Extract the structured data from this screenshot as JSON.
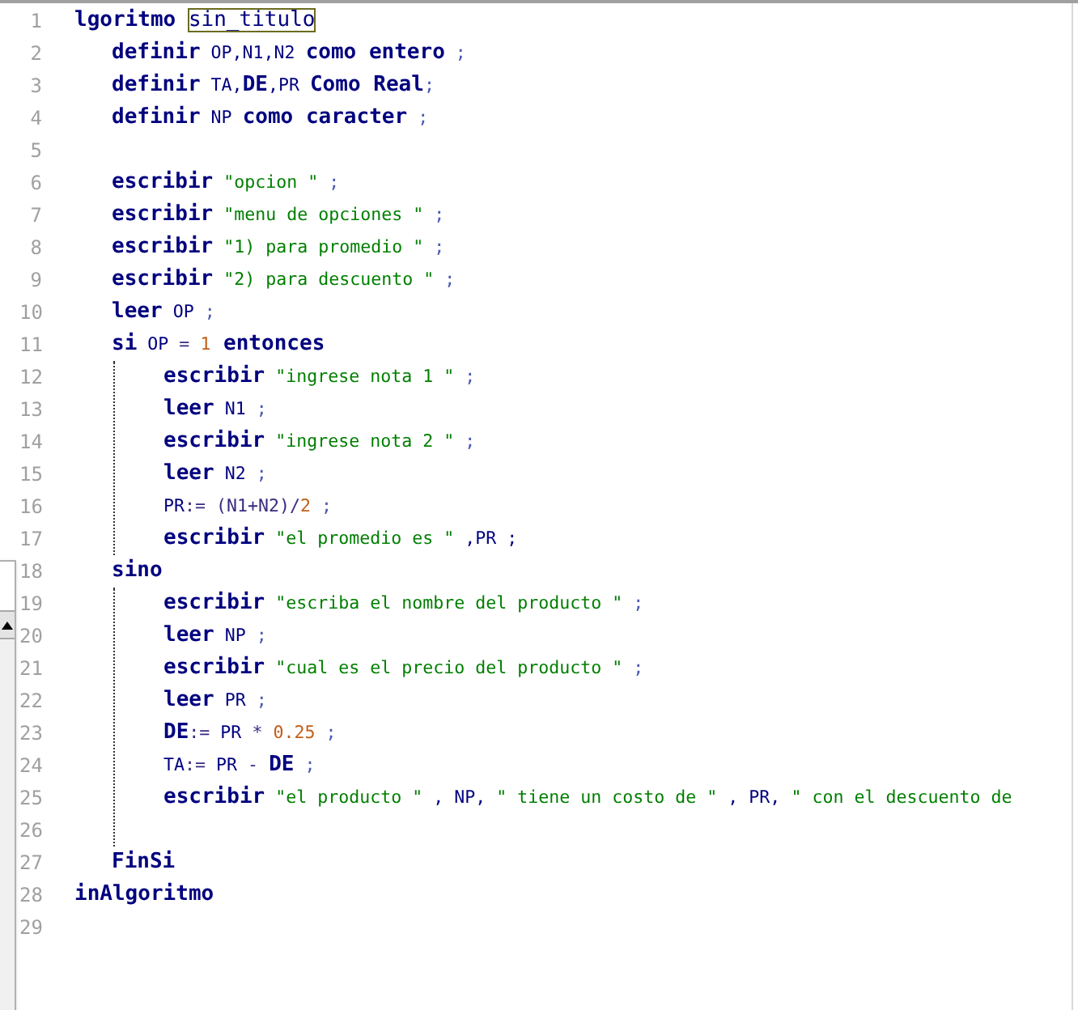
{
  "editor": {
    "lines": [
      {
        "number": "1",
        "tokens": [
          {
            "kind": "keyword",
            "text": "lgoritmo "
          },
          {
            "kind": "marked",
            "text": "sin_titulo"
          }
        ],
        "children": [
          {
            "number": "2",
            "tokens": [
              {
                "kind": "keyword",
                "text": "definir"
              },
              {
                "kind": "ident",
                "text": " OP,N1,N2 "
              },
              {
                "kind": "keyword",
                "text": "como entero"
              },
              {
                "kind": "punct",
                "text": " ;"
              }
            ]
          },
          {
            "number": "3",
            "tokens": [
              {
                "kind": "keyword",
                "text": "definir"
              },
              {
                "kind": "ident",
                "text": " TA,"
              },
              {
                "kind": "keyword",
                "text": "DE"
              },
              {
                "kind": "ident",
                "text": ",PR "
              },
              {
                "kind": "keyword",
                "text": "Como Real"
              },
              {
                "kind": "punct",
                "text": ";"
              }
            ]
          },
          {
            "number": "4",
            "tokens": [
              {
                "kind": "keyword",
                "text": "definir"
              },
              {
                "kind": "ident",
                "text": " NP "
              },
              {
                "kind": "keyword",
                "text": "como caracter"
              },
              {
                "kind": "punct",
                "text": " ;"
              }
            ]
          },
          {
            "number": "5"
          },
          {
            "number": "6",
            "tokens": [
              {
                "kind": "keyword",
                "text": "escribir"
              },
              {
                "kind": "string",
                "text": " \"opcion \""
              },
              {
                "kind": "punct",
                "text": " ;"
              }
            ]
          },
          {
            "number": "7",
            "tokens": [
              {
                "kind": "keyword",
                "text": "escribir"
              },
              {
                "kind": "string",
                "text": " \"menu de opciones \""
              },
              {
                "kind": "punct",
                "text": " ;"
              }
            ]
          },
          {
            "number": "8",
            "tokens": [
              {
                "kind": "keyword",
                "text": "escribir"
              },
              {
                "kind": "string",
                "text": " \"1) para promedio \""
              },
              {
                "kind": "punct",
                "text": " ;"
              }
            ]
          },
          {
            "number": "9",
            "tokens": [
              {
                "kind": "keyword",
                "text": "escribir"
              },
              {
                "kind": "string",
                "text": " \"2) para descuento \""
              },
              {
                "kind": "punct",
                "text": " ;"
              }
            ]
          },
          {
            "number": "10",
            "tokens": [
              {
                "kind": "keyword",
                "text": "leer"
              },
              {
                "kind": "ident",
                "text": " OP"
              },
              {
                "kind": "punct",
                "text": " ;"
              }
            ]
          },
          {
            "number": "11",
            "tokens": [
              {
                "kind": "keyword",
                "text": "si"
              },
              {
                "kind": "ident",
                "text": " OP "
              },
              {
                "kind": "op",
                "text": "= "
              },
              {
                "kind": "number",
                "text": "1"
              },
              {
                "kind": "keyword",
                "text": " entonces"
              }
            ],
            "children": [
              {
                "number": "12",
                "tokens": [
                  {
                    "kind": "keyword",
                    "text": "escribir"
                  },
                  {
                    "kind": "string",
                    "text": " \"ingrese nota 1 \""
                  },
                  {
                    "kind": "punct",
                    "text": " ;"
                  }
                ]
              },
              {
                "number": "13",
                "tokens": [
                  {
                    "kind": "keyword",
                    "text": "leer"
                  },
                  {
                    "kind": "ident",
                    "text": " N1"
                  },
                  {
                    "kind": "punct",
                    "text": " ;"
                  }
                ]
              },
              {
                "number": "14",
                "tokens": [
                  {
                    "kind": "keyword",
                    "text": "escribir"
                  },
                  {
                    "kind": "string",
                    "text": " \"ingrese nota 2 \""
                  },
                  {
                    "kind": "punct",
                    "text": " ;"
                  }
                ]
              },
              {
                "number": "15",
                "tokens": [
                  {
                    "kind": "keyword",
                    "text": "leer"
                  },
                  {
                    "kind": "ident",
                    "text": " N2"
                  },
                  {
                    "kind": "punct",
                    "text": " ;"
                  }
                ]
              },
              {
                "number": "16",
                "tokens": [
                  {
                    "kind": "ident",
                    "text": "PR"
                  },
                  {
                    "kind": "op",
                    "text": ":= (N1+N2)/"
                  },
                  {
                    "kind": "number",
                    "text": "2"
                  },
                  {
                    "kind": "punct",
                    "text": " ;"
                  }
                ]
              },
              {
                "number": "17",
                "tokens": [
                  {
                    "kind": "keyword",
                    "text": "escribir"
                  },
                  {
                    "kind": "string",
                    "text": " \"el promedio es \""
                  },
                  {
                    "kind": "ident",
                    "text": " ,PR ;"
                  }
                ]
              }
            ]
          },
          {
            "number": "18",
            "tokens": [
              {
                "kind": "keyword",
                "text": "sino"
              }
            ],
            "children": [
              {
                "number": "19",
                "tokens": [
                  {
                    "kind": "keyword",
                    "text": "escribir"
                  },
                  {
                    "kind": "string",
                    "text": " \"escriba el nombre del producto \""
                  },
                  {
                    "kind": "punct",
                    "text": " ;"
                  }
                ]
              },
              {
                "number": "20",
                "tokens": [
                  {
                    "kind": "keyword",
                    "text": "leer"
                  },
                  {
                    "kind": "ident",
                    "text": " NP"
                  },
                  {
                    "kind": "punct",
                    "text": " ;"
                  }
                ]
              },
              {
                "number": "21",
                "tokens": [
                  {
                    "kind": "keyword",
                    "text": "escribir"
                  },
                  {
                    "kind": "string",
                    "text": " \"cual es el precio del producto \""
                  },
                  {
                    "kind": "punct",
                    "text": " ;"
                  }
                ]
              },
              {
                "number": "22",
                "tokens": [
                  {
                    "kind": "keyword",
                    "text": "leer"
                  },
                  {
                    "kind": "ident",
                    "text": " PR"
                  },
                  {
                    "kind": "punct",
                    "text": " ;"
                  }
                ]
              },
              {
                "number": "23",
                "tokens": [
                  {
                    "kind": "keyword",
                    "text": "DE"
                  },
                  {
                    "kind": "op",
                    "text": ":="
                  },
                  {
                    "kind": "ident",
                    "text": " PR "
                  },
                  {
                    "kind": "op",
                    "text": "* "
                  },
                  {
                    "kind": "number",
                    "text": "0.25"
                  },
                  {
                    "kind": "punct",
                    "text": " ;"
                  }
                ]
              },
              {
                "number": "24",
                "tokens": [
                  {
                    "kind": "ident",
                    "text": "TA"
                  },
                  {
                    "kind": "op",
                    "text": ":="
                  },
                  {
                    "kind": "ident",
                    "text": " PR "
                  },
                  {
                    "kind": "op",
                    "text": "- "
                  },
                  {
                    "kind": "keyword",
                    "text": "DE"
                  },
                  {
                    "kind": "punct",
                    "text": " ;"
                  }
                ]
              },
              {
                "number": "25",
                "tokens": [
                  {
                    "kind": "keyword",
                    "text": "escribir"
                  },
                  {
                    "kind": "string",
                    "text": " \"el producto \""
                  },
                  {
                    "kind": "ident",
                    "text": " , NP, "
                  },
                  {
                    "kind": "string",
                    "text": "\" tiene un costo de \""
                  },
                  {
                    "kind": "ident",
                    "text": " , PR, "
                  },
                  {
                    "kind": "string",
                    "text": "\" con el descuento de"
                  }
                ]
              },
              {
                "number": "26"
              }
            ]
          },
          {
            "number": "27",
            "tokens": [
              {
                "kind": "keyword",
                "text": "FinSi"
              }
            ]
          }
        ]
      },
      {
        "number": "28",
        "tokens": [
          {
            "kind": "keyword",
            "text": "inAlgoritmo"
          }
        ]
      },
      {
        "number": "29"
      }
    ]
  }
}
